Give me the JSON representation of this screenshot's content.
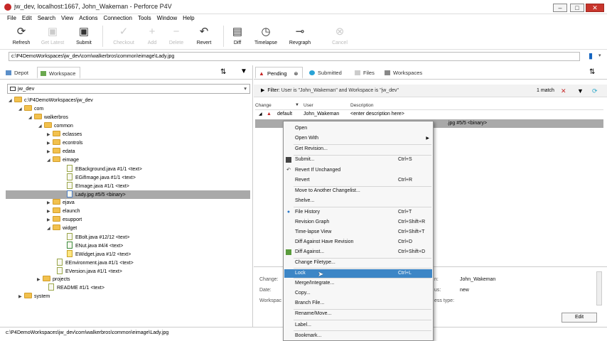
{
  "window": {
    "title": "jw_dev,  localhost:1667,  John_Wakeman - Perforce P4V",
    "min": "–",
    "max": "□",
    "close": "✕"
  },
  "menu": [
    "File",
    "Edit",
    "Search",
    "View",
    "Actions",
    "Connection",
    "Tools",
    "Window",
    "Help"
  ],
  "toolbar": {
    "refresh": "Refresh",
    "get_latest": "Get Latest",
    "submit": "Submit",
    "checkout": "Checkout",
    "add": "Add",
    "delete": "Delete",
    "revert": "Revert",
    "diff": "Diff",
    "timelapse": "Timelapse",
    "revgraph": "Revgraph",
    "cancel": "Cancel"
  },
  "address": "c:\\P4DemoWorkspaces\\jw_dev\\com\\walkerbros\\common\\eimage\\Lady.jpg",
  "left": {
    "tab_depot": "Depot",
    "tab_workspace": "Workspace",
    "workspace_name": "jw_dev",
    "tree": [
      {
        "label": "c:\\P4DemoWorkspaces\\jw_dev"
      },
      {
        "label": "com"
      },
      {
        "label": "walkerbros"
      },
      {
        "label": "common"
      },
      {
        "label": "eclasses"
      },
      {
        "label": "econtrols"
      },
      {
        "label": "edata"
      },
      {
        "label": "eimage"
      },
      {
        "label": "EBackground.java #1/1 <text>"
      },
      {
        "label": "EGifImage.java #1/1 <text>"
      },
      {
        "label": "EImage.java #1/1 <text>"
      },
      {
        "label": "Lady.jpg #5/5 <binary>"
      },
      {
        "label": "ejava"
      },
      {
        "label": "elaunch"
      },
      {
        "label": "esupport"
      },
      {
        "label": "widget"
      },
      {
        "label": "EBolt.java #12/12 <text>"
      },
      {
        "label": "ENut.java #4/4 <text>"
      },
      {
        "label": "EWidget.java #1/2 <text>"
      },
      {
        "label": "EEnvironment.java #1/1 <text>"
      },
      {
        "label": "EVersion.java #1/1 <text>"
      },
      {
        "label": "projects"
      },
      {
        "label": "README #1/1 <text>"
      },
      {
        "label": "system"
      }
    ]
  },
  "right": {
    "tab_pending": "Pending",
    "tab_submitted": "Submitted",
    "tab_files": "Files",
    "tab_workspaces": "Workspaces",
    "filter_label": "Filter:",
    "filter_text": "User is \"John_Wakeman\" and Workspace is \"jw_dev\"",
    "match": "1 match",
    "col_change": "Change",
    "col_user": "User",
    "col_desc": "Description",
    "row_change": "default",
    "row_user": "John_Wakeman",
    "row_desc": "<enter description here>",
    "row_file_tail": ".jpg #5/5 <binary>",
    "details": {
      "change_label": "Change:",
      "date_label": "Date:",
      "workspace_label": "Workspac",
      "user_label": "n:",
      "user_value": "John_Wakeman",
      "status_label": "us:",
      "status_value": "new",
      "type_label": "ess type:",
      "edit": "Edit"
    }
  },
  "status": "c:\\P4DemoWorkspaces\\jw_dev\\com\\walkerbros\\common\\eimage\\Lady.jpg",
  "context_menu": {
    "items": [
      {
        "label": "Open",
        "shortcut": ""
      },
      {
        "label": "Open With",
        "shortcut": ""
      },
      {
        "label": "Get Revision...",
        "shortcut": ""
      },
      {
        "label": "Submit...",
        "shortcut": "Ctrl+S"
      },
      {
        "label": "Revert If Unchanged",
        "shortcut": ""
      },
      {
        "label": "Revert",
        "shortcut": "Ctrl+R"
      },
      {
        "label": "Move to Another Changelist...",
        "shortcut": ""
      },
      {
        "label": "Shelve...",
        "shortcut": ""
      },
      {
        "label": "File History",
        "shortcut": "Ctrl+T"
      },
      {
        "label": "Revision Graph",
        "shortcut": "Ctrl+Shift+R"
      },
      {
        "label": "Time-lapse View",
        "shortcut": "Ctrl+Shift+T"
      },
      {
        "label": "Diff Against Have Revision",
        "shortcut": "Ctrl+D"
      },
      {
        "label": "Diff Against...",
        "shortcut": "Ctrl+Shift+D"
      },
      {
        "label": "Change Filetype...",
        "shortcut": ""
      },
      {
        "label": "Lock",
        "shortcut": "Ctrl+L"
      },
      {
        "label": "Merge/Integrate...",
        "shortcut": ""
      },
      {
        "label": "Copy...",
        "shortcut": ""
      },
      {
        "label": "Branch File...",
        "shortcut": ""
      },
      {
        "label": "Rename/Move...",
        "shortcut": ""
      },
      {
        "label": "Label...",
        "shortcut": ""
      },
      {
        "label": "Bookmark...",
        "shortcut": ""
      }
    ]
  }
}
